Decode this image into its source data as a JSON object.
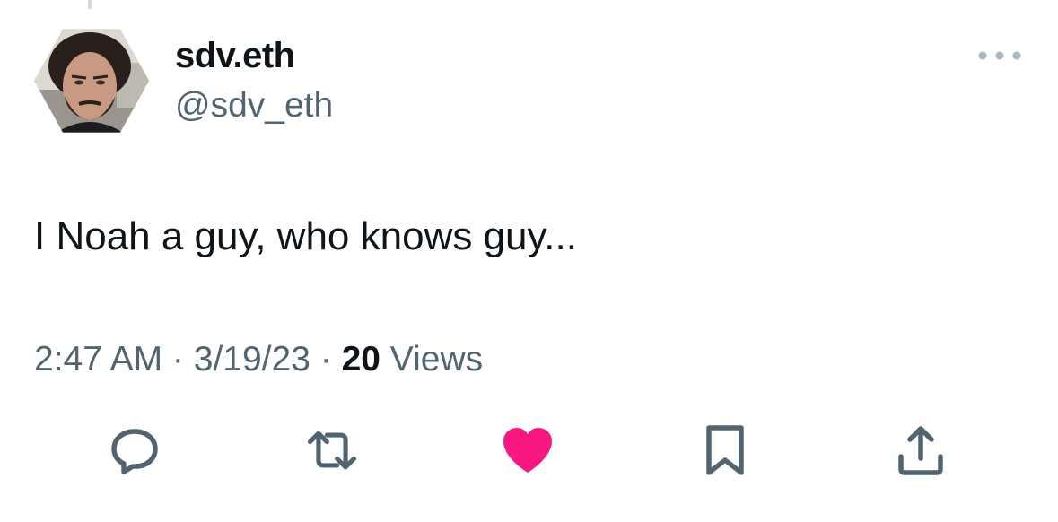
{
  "tweet": {
    "author": {
      "display_name": "sdv.eth",
      "handle": "@sdv_eth",
      "avatar_icon": "profile-photo"
    },
    "text": "I Noah a guy, who knows guy...",
    "meta": {
      "time": "2:47 AM",
      "separator": " · ",
      "date": "3/19/23",
      "views_count": "20",
      "views_label": "Views"
    },
    "actions": [
      {
        "name": "reply",
        "icon": "speech-bubble-icon",
        "color": "#536471"
      },
      {
        "name": "retweet",
        "icon": "retweet-icon",
        "color": "#536471"
      },
      {
        "name": "like",
        "icon": "heart-icon",
        "color": "#f91880",
        "liked": true
      },
      {
        "name": "bookmark",
        "icon": "bookmark-icon",
        "color": "#536471"
      },
      {
        "name": "share",
        "icon": "share-icon",
        "color": "#536471"
      }
    ],
    "more_icon": "more-options-icon"
  },
  "colors": {
    "text_primary": "#0f1419",
    "text_secondary": "#536471",
    "like": "#f91880",
    "background": "#ffffff"
  }
}
